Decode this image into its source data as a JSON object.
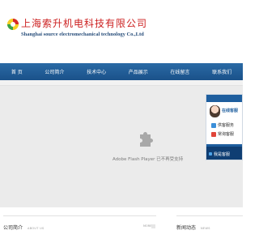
{
  "header": {
    "title_cn": "上海索升机电科技有限公司",
    "title_en": "Shanghai source electromechanical technology Co.,Ltd"
  },
  "nav": {
    "items": [
      "首 页",
      "公司简介",
      "技术中心",
      "产品展示",
      "在线留言",
      "联系我们"
    ]
  },
  "flash": {
    "message": "Adobe Flash Player 已不再受支持",
    "icon": "puzzle-piece-icon"
  },
  "service_panel": {
    "online_label": "在线客服",
    "items": [
      {
        "label": "供客服务",
        "icon": "qq-icon"
      },
      {
        "label": "常询客服",
        "icon": "qq-icon"
      }
    ],
    "footer_label": "我是客服"
  },
  "sections": {
    "about": {
      "title": "公司简介",
      "subtitle": "ABOUT US",
      "more": "MORE+"
    },
    "news": {
      "title": "新闻动态",
      "subtitle": "NEWS"
    }
  },
  "colors": {
    "brand_red": "#cc1f1f",
    "nav_blue": "#1e5e9e",
    "panel_dark": "#0f3e73"
  }
}
